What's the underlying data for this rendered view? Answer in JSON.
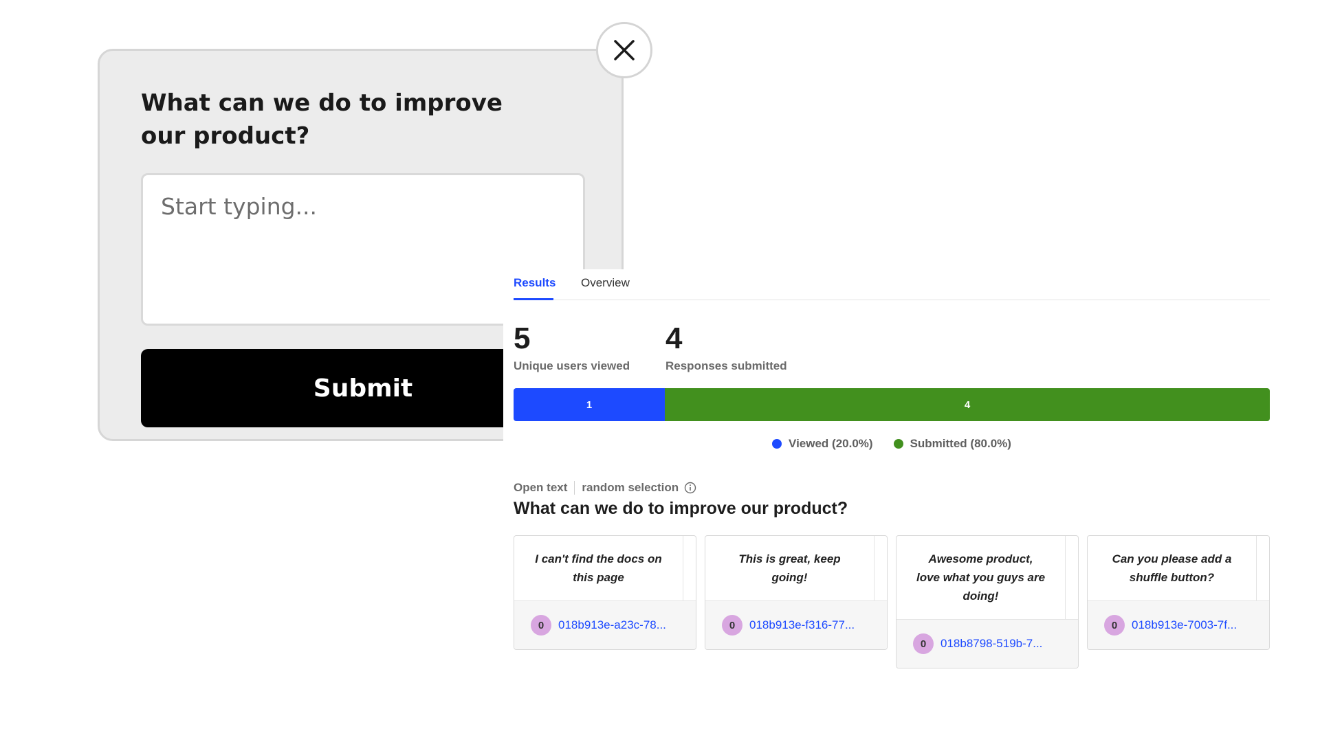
{
  "survey": {
    "question": "What can we do to improve our product?",
    "input_placeholder": "Start typing...",
    "submit_label": "Submit"
  },
  "results": {
    "tabs": [
      {
        "label": "Results",
        "active": true
      },
      {
        "label": "Overview",
        "active": false
      }
    ],
    "stats": [
      {
        "value": "5",
        "label": "Unique users viewed"
      },
      {
        "value": "4",
        "label": "Responses submitted"
      }
    ],
    "bar": [
      {
        "label": "1",
        "fraction": 0.2,
        "color": "#1d4aff"
      },
      {
        "label": "4",
        "fraction": 0.8,
        "color": "#42901e"
      }
    ],
    "legend": [
      {
        "label": "Viewed (20.0%)",
        "color": "#1d4aff"
      },
      {
        "label": "Submitted (80.0%)",
        "color": "#42901e"
      }
    ],
    "question_type": "Open text",
    "selection_mode": "random selection",
    "question": "What can we do to improve our product?",
    "responses": [
      {
        "text": "I can't find the docs on this page",
        "avatar": "0",
        "distinct_id": "018b913e-a23c-78..."
      },
      {
        "text": "This is great, keep going!",
        "avatar": "0",
        "distinct_id": "018b913e-f316-77..."
      },
      {
        "text": "Awesome product, love what you guys are doing!",
        "avatar": "0",
        "distinct_id": "018b8798-519b-7..."
      },
      {
        "text": "Can you please add a shuffle button?",
        "avatar": "0",
        "distinct_id": "018b913e-7003-7f..."
      }
    ]
  }
}
